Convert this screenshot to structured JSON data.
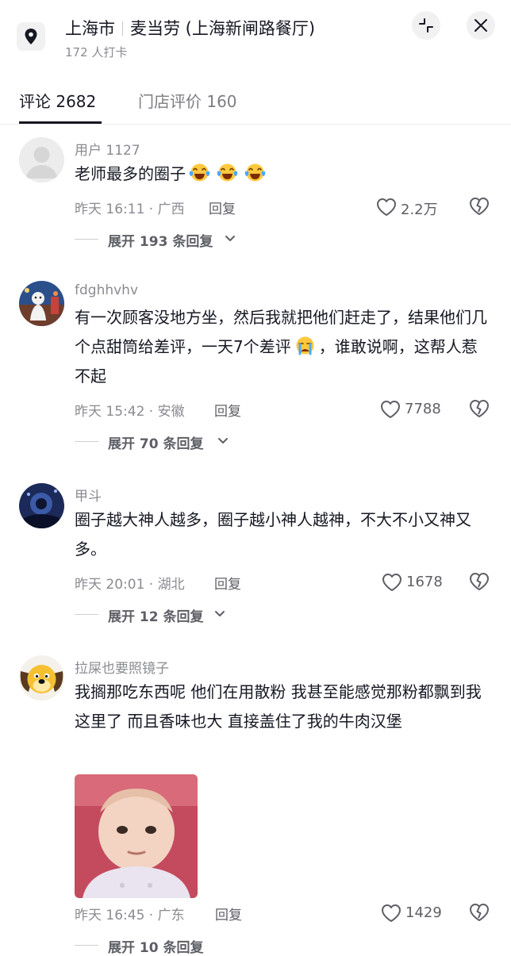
{
  "header": {
    "city": "上海市",
    "store": "麦当劳 (上海新闸路餐厅)",
    "checkin": "172 人打卡"
  },
  "tabs": [
    {
      "label": "评论 2682",
      "active": true
    },
    {
      "label": "门店评价 160",
      "active": false
    }
  ],
  "comments": [
    {
      "user": "用户 1127",
      "text": "老师最多的圈子",
      "meta": "昨天 16:11 · 广西",
      "reply": "回复",
      "likes": "2.2万",
      "expand": "展开 193 条回复"
    },
    {
      "user": "fdghhvhv",
      "text1": "有一次顾客没地方坐，然后我就把他们赶走了，结果他们几个点甜筒给差评，一天7个差评",
      "text2": "，谁敢说啊，这帮人惹不起",
      "meta": "昨天 15:42 · 安徽",
      "reply": "回复",
      "likes": "7788",
      "expand": "展开 70 条回复"
    },
    {
      "user": "甲斗",
      "text": "圈子越大神人越多，圈子越小神人越神，不大不小又神又多。",
      "meta": "昨天 20:01 · 湖北",
      "reply": "回复",
      "likes": "1678",
      "expand": "展开 12 条回复"
    },
    {
      "user": "拉屎也要照镜子",
      "text": "我搁那吃东西呢  他们在用散粉 我甚至能感觉那粉都飘到我这里了  而且香味也大 直接盖住了我的牛肉汉堡",
      "meta": "昨天 16:45 · 广东",
      "reply": "回复",
      "likes": "1429",
      "expand": "展开 10 条回复"
    }
  ],
  "colors": {
    "primary_text": "#161823",
    "secondary_text": "#8a8b91",
    "button_bg": "#f1f1f2"
  }
}
